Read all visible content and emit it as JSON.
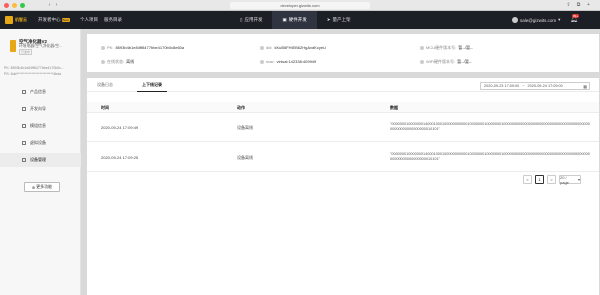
{
  "browser": {
    "url": "developer.gizwits.com"
  },
  "header": {
    "logo_text": "机智云",
    "dev_center": "开发者中心",
    "dev_badge": "Beta",
    "nav_left": [
      "个人项目",
      "服务目录"
    ],
    "nav_tabs": [
      {
        "label": "应用开发",
        "active": false
      },
      {
        "label": "硬件开发",
        "active": true
      },
      {
        "label": "量产上架",
        "active": false
      }
    ],
    "user_email": "sale@gizwits.com",
    "bell_count": "99+"
  },
  "sidebar": {
    "product_name": "空气净化器V2",
    "product_category": "环境电器/空气净化器/空...",
    "product_tag": "已发布",
    "pid_label": "PK:",
    "pid_value": "8593b4b1e84ff8477bbe4170b0c...",
    "pk_label": "PS:",
    "pk_value": "6dd***************************4bda",
    "menu": [
      {
        "label": "产品信息",
        "active": false
      },
      {
        "label": "开发向导",
        "active": false
      },
      {
        "label": "模组信息",
        "active": false
      },
      {
        "label": "虚拟设备",
        "active": false
      },
      {
        "label": "设备管理",
        "active": true
      }
    ],
    "more_button": "更多功能"
  },
  "device_info": {
    "pk_label": "PK:",
    "pk_value": "8593b4b1e84ff8477bbe4170b0c8e60a",
    "did_label": "did:",
    "did_value": "kKuB5FHiEB62HgAvdKcyeU",
    "mcu_label": "MCU硬件版本号:",
    "mcu_value": "暂--/暂--",
    "status_label": "在线状态:",
    "status_value": "离线",
    "mac_label": "mac:",
    "mac_value": "virtual:142338:409949",
    "wifi_label": "WiFi硬件版本号:",
    "wifi_value": "暂--/暂--"
  },
  "logs": {
    "tabs": [
      {
        "label": "设备日志",
        "active": false
      },
      {
        "label": "上下线记录",
        "active": true
      }
    ],
    "date_start": "2020-09-23 17:09:00",
    "date_sep": "~",
    "date_end": "2020-09-24 17:09:00",
    "columns": [
      "时间",
      "动作",
      "数据"
    ],
    "rows": [
      {
        "time": "2020-09-24 17:09:49",
        "action": "设备离线",
        "data": "\"000000010000000140001000100000000000100000001000000010000000000000000000000000000000000000000000000000000000000010101\""
      },
      {
        "time": "2020-09-24 17:09:25",
        "action": "设备离线",
        "data": "\"000000010000000140001000100000000000100000001000000010000000000000000000000000000000000000000000000000000000000010101\""
      }
    ],
    "pager": {
      "prev": "<",
      "current": "1",
      "next": ">",
      "page_size": "20 / page"
    }
  }
}
